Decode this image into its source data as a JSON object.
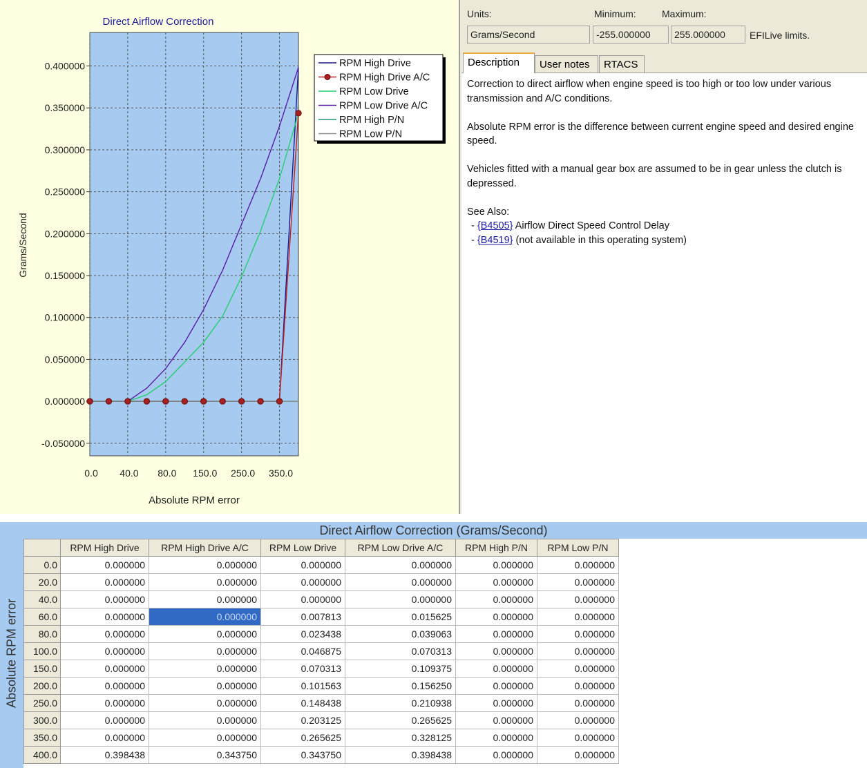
{
  "chart_data": {
    "type": "line",
    "title": "Direct Airflow Correction",
    "xlabel": "Absolute RPM error",
    "ylabel": "Grams/Second",
    "x": [
      0,
      20,
      40,
      60,
      80,
      100,
      150,
      200,
      250,
      300,
      350,
      400
    ],
    "x_tick_labels": [
      "0.0",
      "40.0",
      "80.0",
      "150.0",
      "250.0",
      "350.0"
    ],
    "y_ticks": [
      "0.400000",
      "0.350000",
      "0.300000",
      "0.250000",
      "0.200000",
      "0.150000",
      "0.100000",
      "0.050000",
      "0.000000",
      "-0.050000"
    ],
    "ylim": [
      -0.065,
      0.44
    ],
    "grid": true,
    "legend_position": "top-right",
    "series": [
      {
        "name": "RPM High Drive",
        "color": "#1a1a8c",
        "marker": false,
        "values": [
          0,
          0,
          0,
          0,
          0,
          0,
          0,
          0,
          0,
          0,
          0,
          0.398438
        ]
      },
      {
        "name": "RPM High Drive A/C",
        "color": "#c02020",
        "marker": true,
        "values": [
          0,
          0,
          0,
          0,
          0,
          0,
          0,
          0,
          0,
          0,
          0,
          0.34375
        ]
      },
      {
        "name": "RPM Low Drive",
        "color": "#22d06a",
        "marker": false,
        "values": [
          0,
          0,
          0,
          0.007813,
          0.023438,
          0.046875,
          0.070313,
          0.101563,
          0.148438,
          0.203125,
          0.265625,
          0.34375
        ]
      },
      {
        "name": "RPM Low Drive A/C",
        "color": "#5a1aa8",
        "marker": false,
        "values": [
          0,
          0,
          0,
          0.015625,
          0.039063,
          0.070313,
          0.109375,
          0.15625,
          0.210938,
          0.265625,
          0.328125,
          0.398438
        ]
      },
      {
        "name": "RPM High P/N",
        "color": "#1a9a7a",
        "marker": false,
        "values": [
          0,
          0,
          0,
          0,
          0,
          0,
          0,
          0,
          0,
          0,
          0,
          0
        ]
      },
      {
        "name": "RPM Low P/N",
        "color": "#8a8a8a",
        "marker": false,
        "values": [
          0,
          0,
          0,
          0,
          0,
          0,
          0,
          0,
          0,
          0,
          0,
          0
        ]
      }
    ]
  },
  "units": {
    "units_label": "Units:",
    "units_value": "Grams/Second",
    "min_label": "Minimum:",
    "min_value": "-255.000000",
    "max_label": "Maximum:",
    "max_value": "255.000000",
    "limits_note": "EFILive limits."
  },
  "tabs": [
    "Description",
    "User notes",
    "RTACS"
  ],
  "description": {
    "p1": "Correction to direct airflow when engine speed is too high or too low under various transmission and A/C conditions.",
    "p2": "Absolute RPM error is the difference between current engine speed and desired engine speed.",
    "p3": "Vehicles fitted with a manual gear box are assumed to be in gear unless the clutch is depressed.",
    "see_also": "See Also:",
    "refs": [
      {
        "dash": "- ",
        "link": "{B4505}",
        "text": " Airflow Direct Speed Control Delay"
      },
      {
        "dash": "- ",
        "link": "{B4519}",
        "text": " (not available in this operating system)"
      }
    ]
  },
  "table": {
    "title": "Direct Airflow Correction (Grams/Second)",
    "row_axis_label": "Absolute RPM error",
    "columns": [
      "RPM High Drive",
      "RPM High Drive A/C",
      "RPM Low Drive",
      "RPM Low Drive A/C",
      "RPM High P/N",
      "RPM Low P/N"
    ],
    "selected_cell": [
      3,
      1
    ],
    "rows": [
      {
        "label": "0.0",
        "cells": [
          "0.000000",
          "0.000000",
          "0.000000",
          "0.000000",
          "0.000000",
          "0.000000"
        ]
      },
      {
        "label": "20.0",
        "cells": [
          "0.000000",
          "0.000000",
          "0.000000",
          "0.000000",
          "0.000000",
          "0.000000"
        ]
      },
      {
        "label": "40.0",
        "cells": [
          "0.000000",
          "0.000000",
          "0.000000",
          "0.000000",
          "0.000000",
          "0.000000"
        ]
      },
      {
        "label": "60.0",
        "cells": [
          "0.000000",
          "0.000000",
          "0.007813",
          "0.015625",
          "0.000000",
          "0.000000"
        ]
      },
      {
        "label": "80.0",
        "cells": [
          "0.000000",
          "0.000000",
          "0.023438",
          "0.039063",
          "0.000000",
          "0.000000"
        ]
      },
      {
        "label": "100.0",
        "cells": [
          "0.000000",
          "0.000000",
          "0.046875",
          "0.070313",
          "0.000000",
          "0.000000"
        ]
      },
      {
        "label": "150.0",
        "cells": [
          "0.000000",
          "0.000000",
          "0.070313",
          "0.109375",
          "0.000000",
          "0.000000"
        ]
      },
      {
        "label": "200.0",
        "cells": [
          "0.000000",
          "0.000000",
          "0.101563",
          "0.156250",
          "0.000000",
          "0.000000"
        ]
      },
      {
        "label": "250.0",
        "cells": [
          "0.000000",
          "0.000000",
          "0.148438",
          "0.210938",
          "0.000000",
          "0.000000"
        ]
      },
      {
        "label": "300.0",
        "cells": [
          "0.000000",
          "0.000000",
          "0.203125",
          "0.265625",
          "0.000000",
          "0.000000"
        ]
      },
      {
        "label": "350.0",
        "cells": [
          "0.000000",
          "0.000000",
          "0.265625",
          "0.328125",
          "0.000000",
          "0.000000"
        ]
      },
      {
        "label": "400.0",
        "cells": [
          "0.398438",
          "0.343750",
          "0.343750",
          "0.398438",
          "0.000000",
          "0.000000"
        ]
      }
    ]
  }
}
